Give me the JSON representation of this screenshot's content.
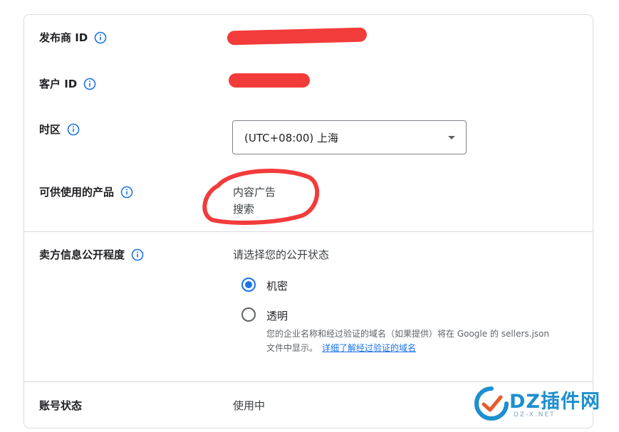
{
  "rows": {
    "publisher_id": {
      "label": "发布商 ID"
    },
    "customer_id": {
      "label": "客户 ID"
    },
    "timezone": {
      "label": "时区",
      "selected": "(UTC+08:00) 上海"
    },
    "products": {
      "label": "可供使用的产品",
      "items": [
        "内容广告",
        "搜索"
      ]
    },
    "seller_info": {
      "label": "卖方信息公开程度",
      "prompt": "请选择您的公开状态",
      "options": [
        {
          "label": "机密",
          "checked": true
        },
        {
          "label": "透明",
          "checked": false
        }
      ],
      "help_line1": "您的企业名称和经过验证的域名（如果提供）将在 Google 的 sellers.json",
      "help_line2": "文件中显示。",
      "help_link": "详细了解经过验证的域名"
    },
    "account_status": {
      "label": "账号状态",
      "value": "使用中"
    }
  },
  "watermark": {
    "text": "DZ插件网",
    "sub": "DZ-X.NET"
  },
  "colors": {
    "accent": "#1a73e8",
    "redaction": "#f23b3b",
    "border": "#dadce0"
  }
}
